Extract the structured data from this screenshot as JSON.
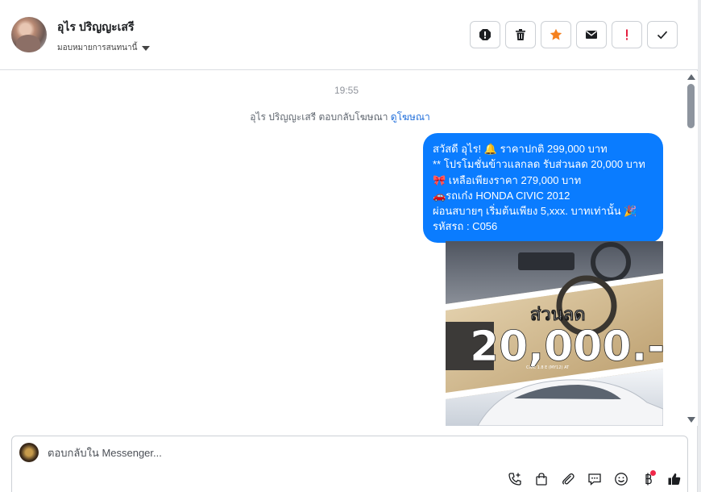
{
  "header": {
    "contact_name": "อุไร ปริญญะเสรี",
    "assign_label": "มอบหมายการสนทนานี้",
    "actions": [
      {
        "name": "report-icon",
        "label": "report"
      },
      {
        "name": "trash-icon",
        "label": "delete"
      },
      {
        "name": "star-icon",
        "label": "star"
      },
      {
        "name": "envelope-icon",
        "label": "mark unread"
      },
      {
        "name": "exclamation-icon",
        "label": "spam"
      },
      {
        "name": "check-icon",
        "label": "done"
      }
    ]
  },
  "conversation": {
    "timestamp": "19:55",
    "system_message": "อุไร ปริญญะเสรี ตอบกลับโฆษณา",
    "system_link": "ดูโฆษณา",
    "message_lines": [
      "สวัสดี อุไร! 🔔 ราคาปกติ  299,000 บาท",
      "** โปรโมชั่นข้าวแลกลด รับส่วนลด 20,000 บาท",
      "🎀  เหลือเพียงราคา 279,000 บาท",
      "🚗รถเก๋ง HONDA CIVIC 2012",
      "ผ่อนสบายๆ เริ่มต้นเพียง 5,xxx. บาทเท่านั้น  🎉",
      " รหัสรถ : C056"
    ],
    "photo": {
      "headline": "ส่วนลด",
      "amount": "20,000.-",
      "caption": "Civic 1.8 E (MY12) AT"
    }
  },
  "composer": {
    "placeholder": "ตอบกลับใน Messenger..."
  },
  "colors": {
    "bubble": "#0a7cff",
    "link": "#216fdb",
    "star": "#f5811f",
    "alert": "#e41e3f"
  }
}
